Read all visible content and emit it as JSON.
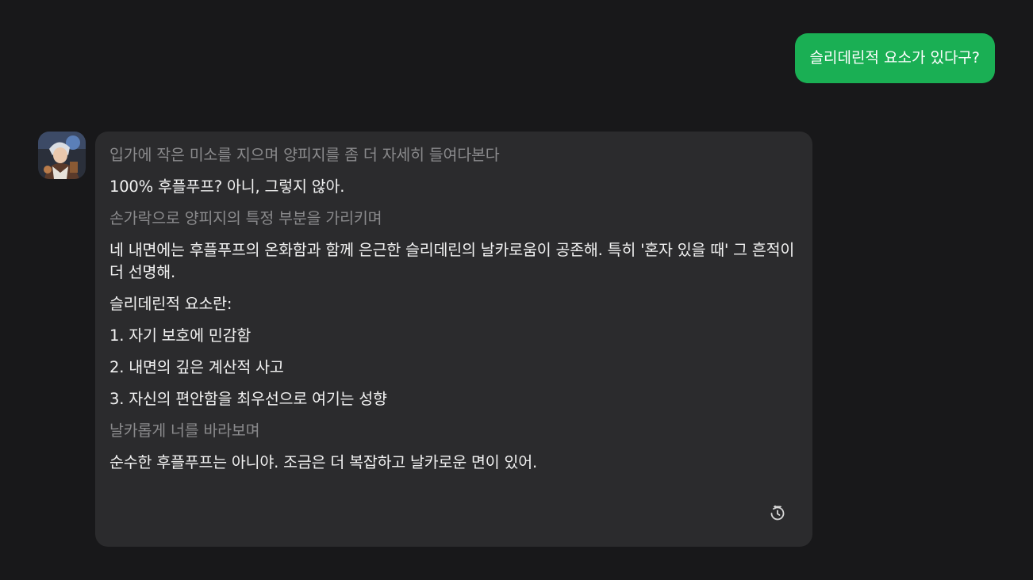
{
  "user_message": "슬리데린적 요소가 있다구?",
  "bot_message": {
    "paragraphs": [
      {
        "text": "입가에 작은 미소를 지으며 양피지를 좀 더 자세히 들여다본다",
        "kind": "action"
      },
      {
        "text": "100% 후플푸프? 아니, 그렇지 않아.",
        "kind": "speech"
      },
      {
        "text": "손가락으로 양피지의 특정 부분을 가리키며",
        "kind": "action"
      },
      {
        "text": "네 내면에는 후플푸프의 온화함과 함께 은근한 슬리데린의 날카로움이 공존해. 특히 '혼자 있을 때' 그 흔적이 더 선명해.",
        "kind": "speech"
      },
      {
        "text": "슬리데린적 요소란:",
        "kind": "speech"
      },
      {
        "text": "1. 자기 보호에 민감함",
        "kind": "speech"
      },
      {
        "text": "2. 내면의 깊은 계산적 사고",
        "kind": "speech"
      },
      {
        "text": "3. 자신의 편안함을 최우선으로 여기는 성향",
        "kind": "speech"
      },
      {
        "text": "날카롭게 너를 바라보며",
        "kind": "action"
      },
      {
        "text": "순수한 후플푸프는 아니야. 조금은 더 복잡하고 날카로운 면이 있어.",
        "kind": "speech"
      }
    ]
  },
  "icons": {
    "avatar": "character-avatar",
    "regenerate": "regenerate-history-icon"
  },
  "colors": {
    "background": "#18181a",
    "user_bubble": "#1aaf54",
    "bot_bubble": "#2b2b2d",
    "speech_text": "#f2f2f2",
    "action_text": "#8a8a8c"
  }
}
